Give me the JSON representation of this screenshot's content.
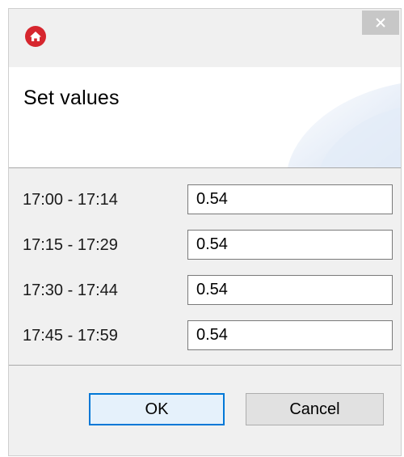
{
  "window": {
    "app_icon": "home-icon",
    "close_icon": "close-icon",
    "close_label": "✕"
  },
  "header": {
    "title": "Set values"
  },
  "rows": [
    {
      "label": "17:00 - 17:14",
      "value": "0.54"
    },
    {
      "label": "17:15 - 17:29",
      "value": "0.54"
    },
    {
      "label": "17:30 - 17:44",
      "value": "0.54"
    },
    {
      "label": "17:45 - 17:59",
      "value": "0.54"
    }
  ],
  "buttons": {
    "ok_label": "OK",
    "cancel_label": "Cancel"
  },
  "colors": {
    "app_icon": "#d6262e",
    "ok_border": "#0078d7",
    "header_accent": "#dbe6f5"
  }
}
